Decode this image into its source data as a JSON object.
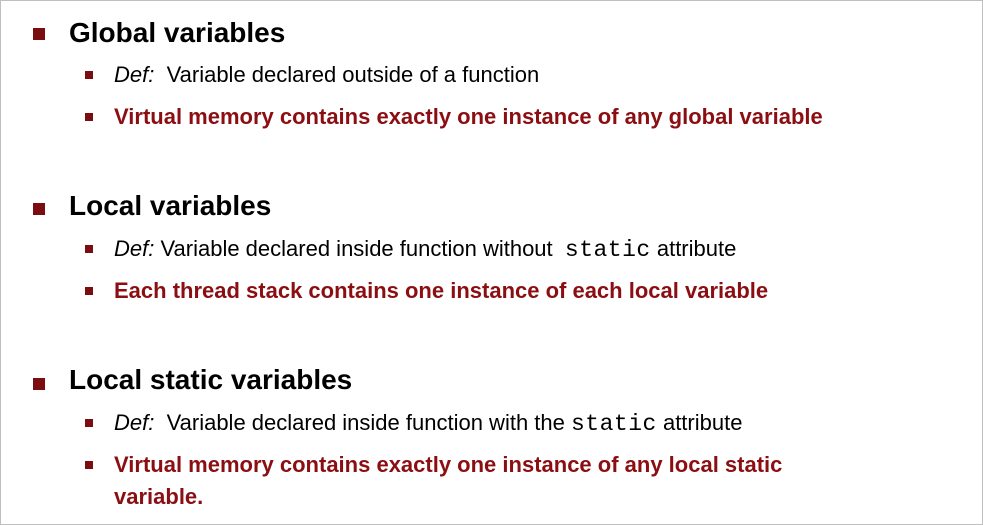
{
  "colors": {
    "accent": "#7a0d0f",
    "emphasis_text": "#8b0f12",
    "body_text": "#000000",
    "border": "#bfbfbf"
  },
  "sections": [
    {
      "heading": "Global variables",
      "items": [
        {
          "prefix": "Def:",
          "text_before": "Variable declared outside of a function",
          "code": "",
          "text_after": ""
        },
        {
          "text": "Virtual memory contains exactly one instance of any global variable"
        }
      ]
    },
    {
      "heading": "Local variables",
      "items": [
        {
          "prefix": "Def:",
          "text_before": "Variable declared inside function without",
          "code": "static",
          "text_after": "attribute"
        },
        {
          "text": "Each thread stack contains one instance of each local variable"
        }
      ]
    },
    {
      "heading": "Local static variables",
      "items": [
        {
          "prefix": "Def:",
          "text_before": "Variable declared inside  function with the",
          "code": "static",
          "text_after": "attribute"
        },
        {
          "text_line1": "Virtual memory contains exactly one instance of any local static",
          "text_line2": "variable."
        }
      ]
    }
  ]
}
